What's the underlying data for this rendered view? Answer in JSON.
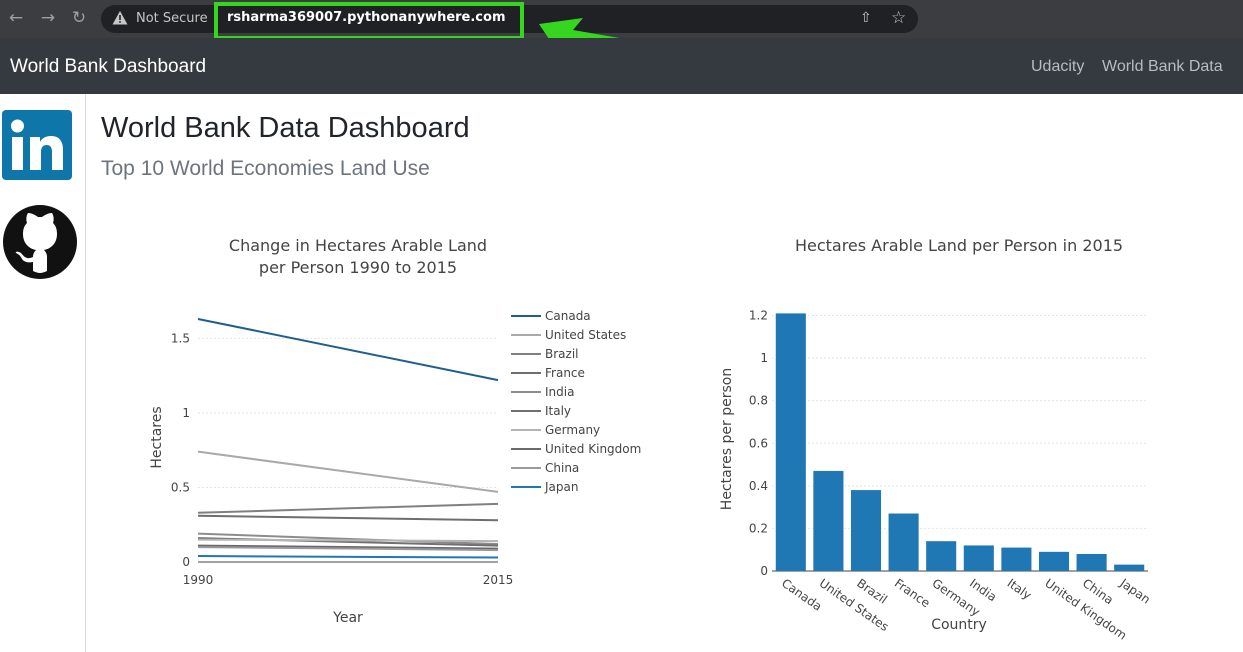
{
  "browser": {
    "security_label": "Not Secure",
    "url": "rsharma369007.pythonanywhere.com",
    "highlight_color": "#36d520"
  },
  "navbar": {
    "brand": "World Bank Dashboard",
    "links": [
      "Udacity",
      "World Bank Data"
    ]
  },
  "sidebar": {
    "icons": [
      "linkedin-icon",
      "github-icon"
    ]
  },
  "page": {
    "title": "World Bank Data Dashboard",
    "subtitle": "Top 10 World Economies Land Use"
  },
  "chart_data": [
    {
      "type": "line",
      "title": [
        "Change in Hectares Arable Land",
        "per Person 1990 to 2015"
      ],
      "xlabel": "Year",
      "ylabel": "Hectares",
      "x": [
        1990,
        2015
      ],
      "xticks": [
        "1990",
        "2015"
      ],
      "yticks": [
        0,
        0.5,
        1,
        1.5
      ],
      "ytick_labels": [
        "0",
        "0.5",
        "1",
        "1.5"
      ],
      "ylim": [
        0,
        1.67
      ],
      "legend_position": "right",
      "series": [
        {
          "name": "Canada",
          "values": [
            1.63,
            1.22
          ],
          "color": "#1f5f8b"
        },
        {
          "name": "United States",
          "values": [
            0.74,
            0.47
          ],
          "color": "#a9a9a9"
        },
        {
          "name": "Brazil",
          "values": [
            0.33,
            0.39
          ],
          "color": "#808080"
        },
        {
          "name": "France",
          "values": [
            0.31,
            0.28
          ],
          "color": "#6e6e6e"
        },
        {
          "name": "India",
          "values": [
            0.19,
            0.12
          ],
          "color": "#8c8c8c"
        },
        {
          "name": "Italy",
          "values": [
            0.16,
            0.11
          ],
          "color": "#707070"
        },
        {
          "name": "Germany",
          "values": [
            0.15,
            0.14
          ],
          "color": "#b4b4b4"
        },
        {
          "name": "United Kingdom",
          "values": [
            0.11,
            0.09
          ],
          "color": "#6a6a6a"
        },
        {
          "name": "China",
          "values": [
            0.1,
            0.08
          ],
          "color": "#9a9a9a"
        },
        {
          "name": "Japan",
          "values": [
            0.04,
            0.03
          ],
          "color": "#1f77b4"
        }
      ]
    },
    {
      "type": "bar",
      "title": "Hectares Arable Land per Person in 2015",
      "xlabel": "Country",
      "ylabel": "Hectares per person",
      "categories": [
        "Canada",
        "United States",
        "Brazil",
        "France",
        "Germany",
        "India",
        "Italy",
        "United Kingdom",
        "China",
        "Japan"
      ],
      "values": [
        1.21,
        0.47,
        0.38,
        0.27,
        0.14,
        0.12,
        0.11,
        0.09,
        0.08,
        0.03
      ],
      "yticks": [
        0,
        0.2,
        0.4,
        0.6,
        0.8,
        1,
        1.2
      ],
      "ytick_labels": [
        "0",
        "0.2",
        "0.4",
        "0.6",
        "0.8",
        "1",
        "1.2"
      ],
      "ylim": [
        0,
        1.24
      ],
      "bar_color": "#1f77b4"
    }
  ]
}
